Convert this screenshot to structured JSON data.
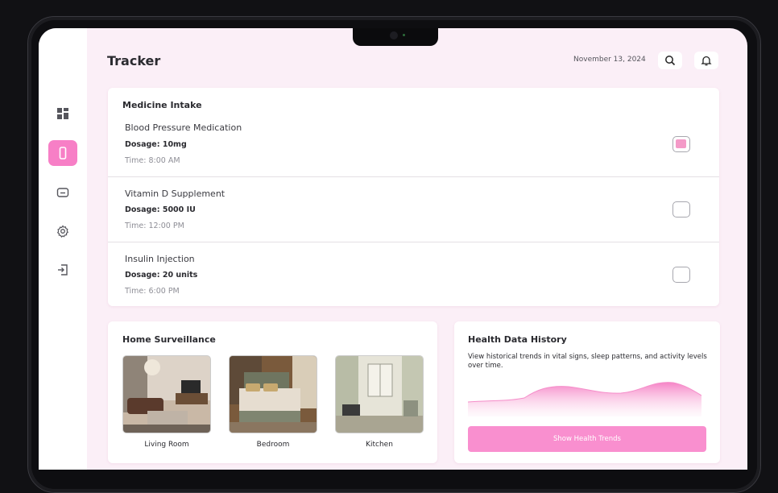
{
  "header": {
    "title": "Tracker",
    "date": "November 13, 2024",
    "search_icon": "search-icon",
    "bell_icon": "bell-icon"
  },
  "sidebar": {
    "items": [
      {
        "icon": "dashboard-icon",
        "active": false
      },
      {
        "icon": "phone-icon",
        "active": true
      },
      {
        "icon": "chat-icon",
        "active": false
      },
      {
        "icon": "gear-icon",
        "active": false
      },
      {
        "icon": "logout-icon",
        "active": false
      }
    ]
  },
  "medicine": {
    "title": "Medicine Intake",
    "items": [
      {
        "name": "Blood Pressure Medication",
        "dosage": "Dosage: 10mg",
        "time": "Time: 8:00 AM",
        "checked": true
      },
      {
        "name": "Vitamin D Supplement",
        "dosage": "Dosage: 5000 IU",
        "time": "Time: 12:00 PM",
        "checked": false
      },
      {
        "name": "Insulin Injection",
        "dosage": "Dosage: 20 units",
        "time": "Time: 6:00 PM",
        "checked": false
      }
    ]
  },
  "surveillance": {
    "title": "Home Surveillance",
    "cameras": [
      {
        "label": "Living Room"
      },
      {
        "label": "Bedroom"
      },
      {
        "label": "Kitchen"
      }
    ]
  },
  "health": {
    "title": "Health Data History",
    "description": "View historical trends in vital signs, sleep patterns, and activity levels over time.",
    "button_label": "Show Health Trends"
  },
  "colors": {
    "accent": "#f77fc6",
    "background": "#fbeff7"
  }
}
